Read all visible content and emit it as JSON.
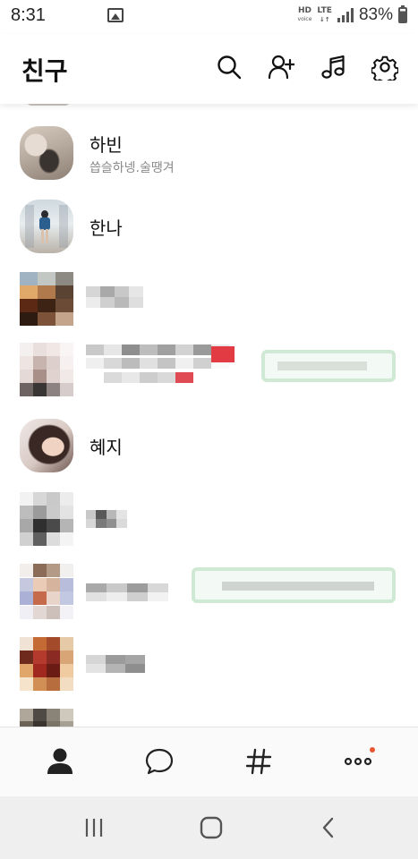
{
  "status_bar": {
    "time": "8:31",
    "hd_label": "HD",
    "hd_sub": "voice",
    "lte_label": "LTE",
    "battery_pct": "83%",
    "icons": [
      "gallery-icon",
      "hd-voice-icon",
      "lte-icon",
      "signal-icon",
      "battery-icon"
    ]
  },
  "header": {
    "title": "친구",
    "icons": [
      "search-icon",
      "add-friend-icon",
      "music-icon",
      "settings-icon"
    ]
  },
  "friends": [
    {
      "name": "하빈",
      "status": "씁슬하넹.술땡겨"
    },
    {
      "name": "한나",
      "status": ""
    },
    {
      "name": "",
      "status": "",
      "pixelated": true
    },
    {
      "name": "",
      "status": "",
      "pixelated": true,
      "has_status_pill": true
    },
    {
      "name": "혜지",
      "status": ""
    },
    {
      "name": "",
      "status": "",
      "pixelated": true
    },
    {
      "name": "",
      "status": "",
      "pixelated": true,
      "has_status_pill": true
    },
    {
      "name": "",
      "status": "",
      "pixelated": true
    }
  ],
  "bottom_nav": {
    "items": [
      "friends-tab-icon",
      "chats-tab-icon",
      "hashtag-tab-icon",
      "more-tab-icon"
    ],
    "active": "friends-tab-icon",
    "accent": "#e8552e"
  },
  "android_nav": [
    "recent-apps-icon",
    "home-icon",
    "back-icon"
  ],
  "colors": {
    "text": "#111111",
    "status_text": "#8a8a8a",
    "status_pill_border": "#cfe9d4"
  }
}
